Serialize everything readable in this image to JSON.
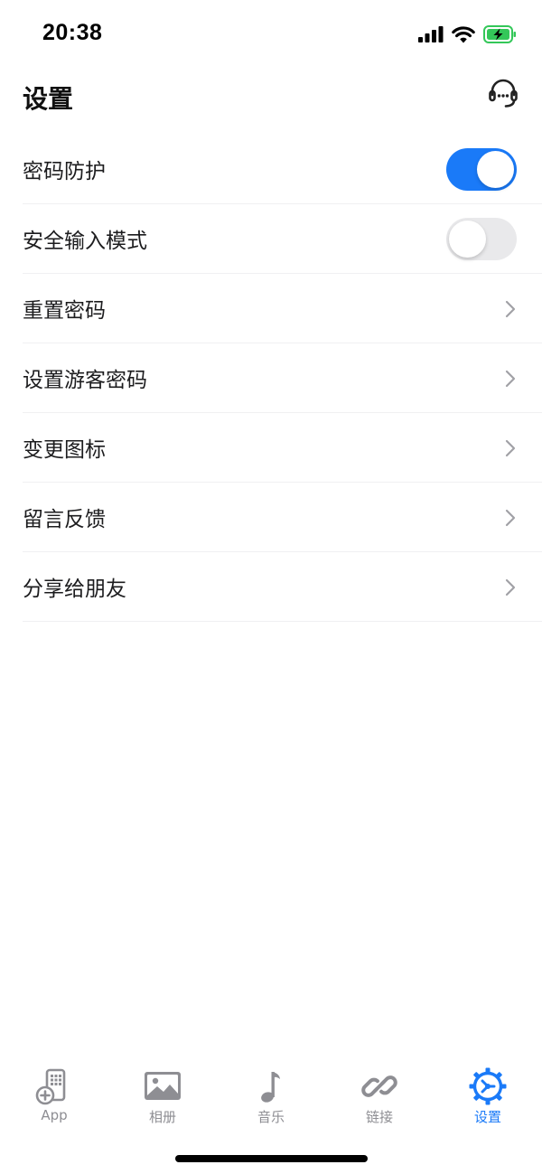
{
  "status_bar": {
    "time": "20:38",
    "icons": [
      "cellular-signal-icon",
      "wifi-icon",
      "battery-charging-icon"
    ],
    "battery_color": "#34c759"
  },
  "header": {
    "title": "设置",
    "action_icon": "headset-support-icon"
  },
  "settings": [
    {
      "label": "密码防护",
      "control": "toggle",
      "on": true
    },
    {
      "label": "安全输入模式",
      "control": "toggle",
      "on": false
    },
    {
      "label": "重置密码",
      "control": "chevron"
    },
    {
      "label": "设置游客密码",
      "control": "chevron"
    },
    {
      "label": "变更图标",
      "control": "chevron"
    },
    {
      "label": "留言反馈",
      "control": "chevron"
    },
    {
      "label": "分享给朋友",
      "control": "chevron"
    }
  ],
  "tab_bar": {
    "tabs": [
      {
        "label": "App",
        "icon": "app-add-icon",
        "active": false
      },
      {
        "label": "相册",
        "icon": "photo-album-icon",
        "active": false
      },
      {
        "label": "音乐",
        "icon": "music-note-icon",
        "active": false
      },
      {
        "label": "链接",
        "icon": "link-icon",
        "active": false
      },
      {
        "label": "设置",
        "icon": "settings-gear-icon",
        "active": true
      }
    ]
  },
  "colors": {
    "accent": "#1a7af8",
    "inactive": "#8e8e93",
    "toggle_off": "#e9e9eb"
  }
}
